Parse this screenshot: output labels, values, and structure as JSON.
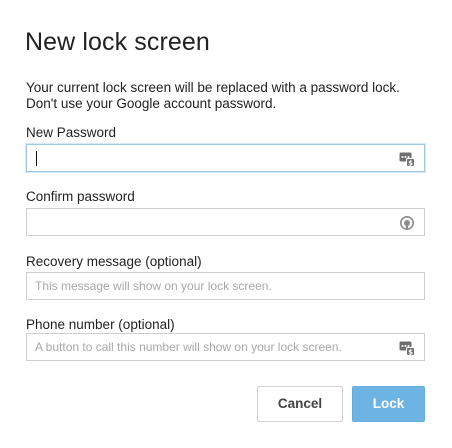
{
  "dialog": {
    "title": "New lock screen",
    "description_line1": "Your current lock screen will be replaced with a password lock.",
    "description_line2": "Don't use your Google account password."
  },
  "fields": {
    "new_password": {
      "label": "New Password",
      "value": "",
      "placeholder": "",
      "icon": "password-manager-icon"
    },
    "confirm_password": {
      "label": "Confirm password",
      "value": "",
      "placeholder": "",
      "icon": "password-reveal-icon"
    },
    "recovery_message": {
      "label": "Recovery message (optional)",
      "value": "",
      "placeholder": "This message will show on your lock screen."
    },
    "phone_number": {
      "label": "Phone number (optional)",
      "value": "",
      "placeholder": "A button to call this number will show on your lock screen.",
      "icon": "password-manager-icon"
    }
  },
  "buttons": {
    "cancel_label": "Cancel",
    "lock_label": "Lock"
  },
  "colors": {
    "primary_button": "#6db4e4",
    "focus_border": "#9ec8e6",
    "placeholder_text": "#a8a8a8"
  }
}
